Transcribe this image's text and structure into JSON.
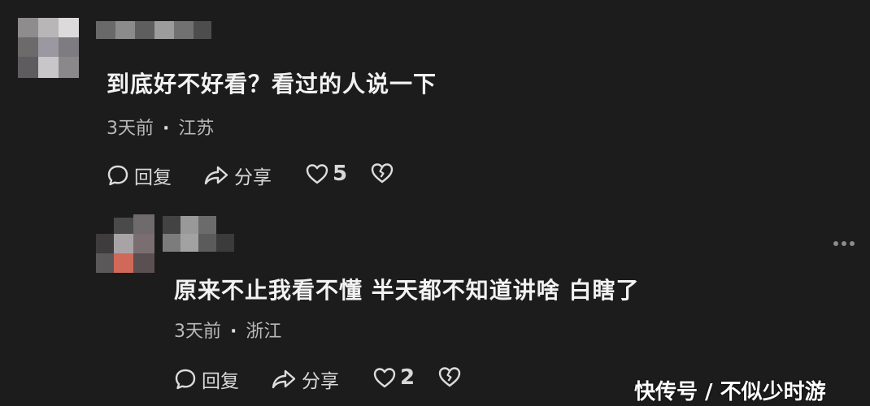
{
  "comments": [
    {
      "text": "到底好不好看？看过的人说一下",
      "time": "3天前",
      "location": "江苏",
      "actions": {
        "reply_label": "回复",
        "share_label": "分享",
        "like_count": "5"
      }
    },
    {
      "text": "原来不止我看不懂 半天都不知道讲啥 白瞎了",
      "time": "3天前",
      "location": "浙江",
      "actions": {
        "reply_label": "回复",
        "share_label": "分享",
        "like_count": "2"
      }
    }
  ],
  "separator": "·",
  "watermark": "快传号 / 不似少时游",
  "icons": [
    "comment-bubble-icon",
    "share-arrow-icon",
    "heart-icon",
    "broken-heart-icon",
    "more-dots-icon"
  ],
  "colors": {
    "background": "#1d1c1c",
    "text_primary": "#f2f2f2",
    "text_secondary": "#b9b9b9"
  }
}
